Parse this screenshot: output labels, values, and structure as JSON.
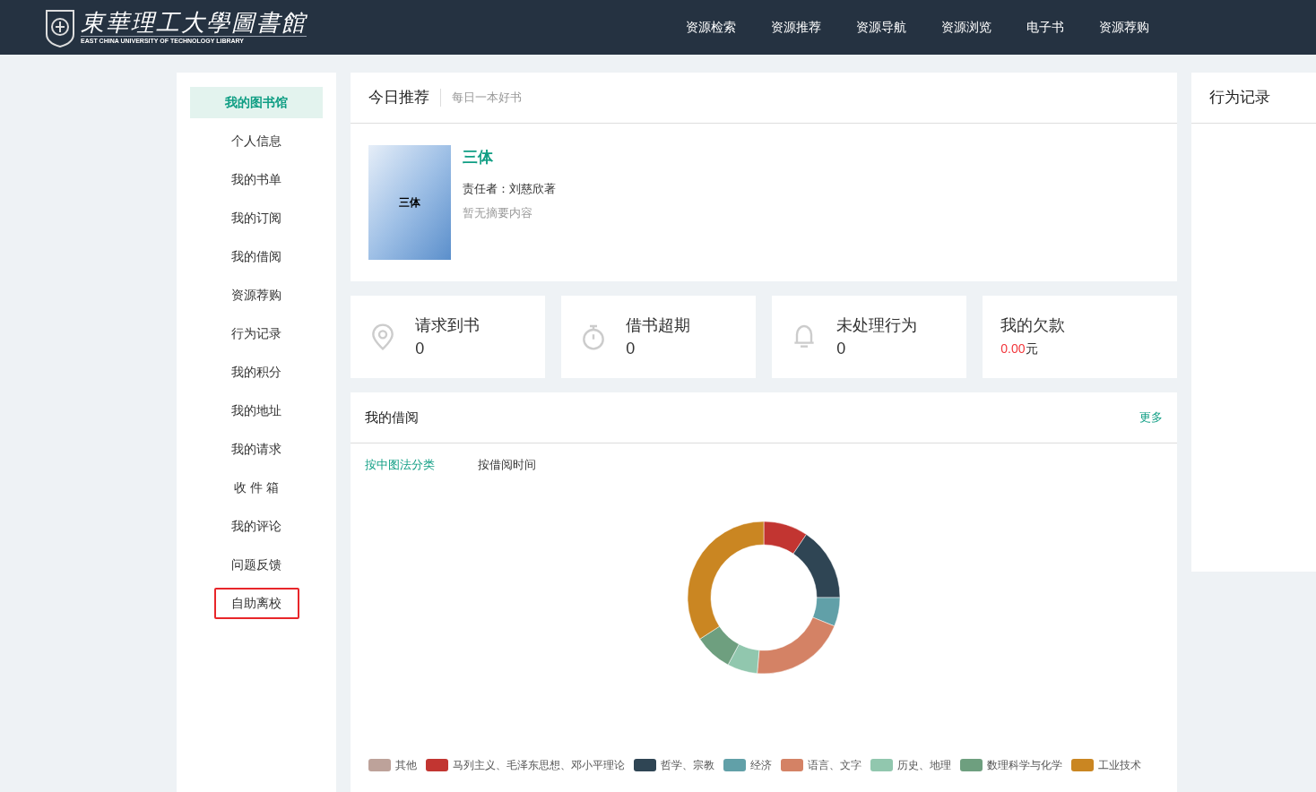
{
  "header": {
    "logo_title": "東華理工大學圖書館",
    "logo_subtitle": "EAST CHINA UNIVERSITY OF TECHNOLOGY LIBRARY",
    "nav": [
      "资源检索",
      "资源推荐",
      "资源导航",
      "资源浏览",
      "电子书",
      "资源荐购"
    ]
  },
  "sidebar": {
    "items": [
      {
        "label": "我的图书馆",
        "selected": true,
        "highlighted": false
      },
      {
        "label": "个人信息",
        "selected": false,
        "highlighted": false
      },
      {
        "label": "我的书单",
        "selected": false,
        "highlighted": false
      },
      {
        "label": "我的订阅",
        "selected": false,
        "highlighted": false
      },
      {
        "label": "我的借阅",
        "selected": false,
        "highlighted": false
      },
      {
        "label": "资源荐购",
        "selected": false,
        "highlighted": false
      },
      {
        "label": "行为记录",
        "selected": false,
        "highlighted": false
      },
      {
        "label": "我的积分",
        "selected": false,
        "highlighted": false
      },
      {
        "label": "我的地址",
        "selected": false,
        "highlighted": false
      },
      {
        "label": "我的请求",
        "selected": false,
        "highlighted": false
      },
      {
        "label": "收 件 箱",
        "selected": false,
        "highlighted": false
      },
      {
        "label": "我的评论",
        "selected": false,
        "highlighted": false
      },
      {
        "label": "问题反馈",
        "selected": false,
        "highlighted": false
      },
      {
        "label": "自助离校",
        "selected": false,
        "highlighted": true
      }
    ]
  },
  "recommend": {
    "title": "今日推荐",
    "subtitle": "每日一本好书",
    "book": {
      "cover_text": "三体",
      "title": "三体",
      "author": "责任者：刘慈欣著",
      "summary": "暂无摘要内容"
    }
  },
  "stats": [
    {
      "kind": "pin",
      "label": "请求到书",
      "value": "0"
    },
    {
      "kind": "timer",
      "label": "借书超期",
      "value": "0"
    },
    {
      "kind": "bell",
      "label": "未处理行为",
      "value": "0"
    },
    {
      "kind": "money",
      "label": "我的欠款",
      "value": "0.00",
      "unit": "元"
    }
  ],
  "borrow": {
    "title": "我的借阅",
    "more": "更多",
    "tabs": [
      {
        "label": "按中图法分类",
        "selected": true
      },
      {
        "label": "按借阅时间",
        "selected": false
      }
    ],
    "legend": [
      {
        "label": "其他",
        "color": "#bda29a"
      },
      {
        "label": "马列主义、毛泽东思想、邓小平理论",
        "color": "#c23531"
      },
      {
        "label": "哲学、宗教",
        "color": "#2f4554"
      },
      {
        "label": "经济",
        "color": "#61a0a8"
      },
      {
        "label": "语言、文字",
        "color": "#d48265"
      },
      {
        "label": "历史、地理",
        "color": "#91c7ae"
      },
      {
        "label": "数理科学与化学",
        "color": "#6e9f7f"
      },
      {
        "label": "工业技术",
        "color": "#ca8622"
      }
    ]
  },
  "side_panel": {
    "title": "行为记录"
  }
}
